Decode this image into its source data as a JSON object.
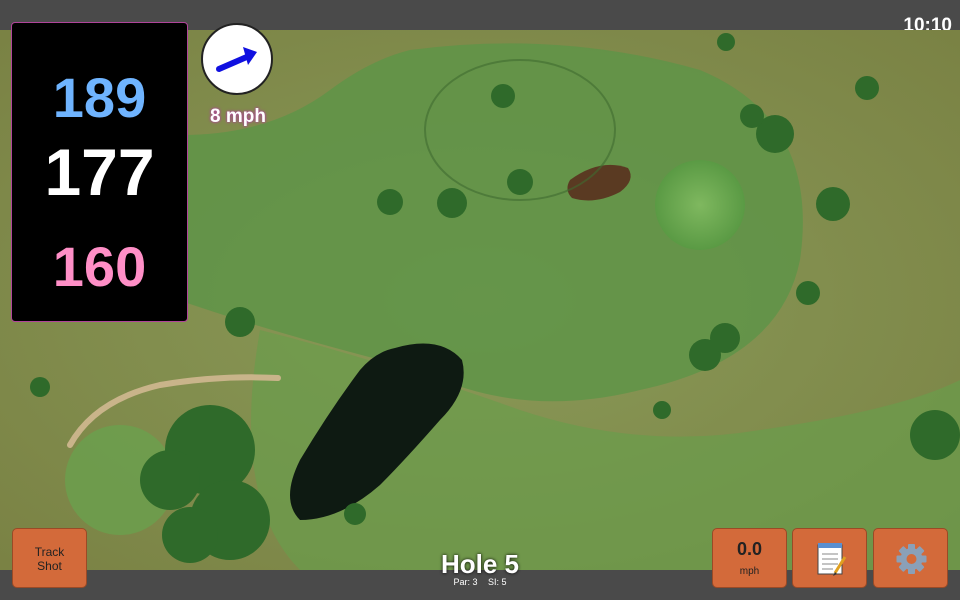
{
  "clock": "10:10",
  "yardages": {
    "back": "189",
    "middle": "177",
    "front": "160"
  },
  "wind": {
    "speed": "8 mph",
    "icon": "wind-arrow-icon"
  },
  "hole": {
    "title": "Hole 5",
    "par": "Par: 3",
    "stroke_index": "SI: 5"
  },
  "buttons": {
    "track_shot": {
      "line1": "Track",
      "line2": "Shot"
    },
    "speed": {
      "value": "0.0",
      "unit": "mph"
    },
    "notes": {
      "icon": "notepad-icon"
    },
    "settings": {
      "icon": "gear-icon"
    }
  },
  "colors": {
    "accent_button": "#d36a3a",
    "yardage_back": "#6fb4ff",
    "yardage_middle": "#ffffff",
    "yardage_front": "#ff8fc7",
    "wind_arrow": "#1010e0"
  }
}
